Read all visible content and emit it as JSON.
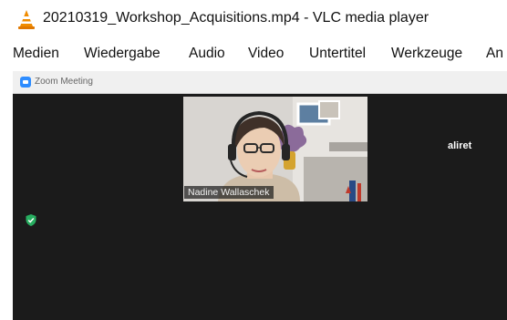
{
  "window": {
    "title": "20210319_Workshop_Acquisitions.mp4 - VLC media player",
    "icon": "vlc-cone-icon"
  },
  "menu": [
    {
      "label": "Medien"
    },
    {
      "label": "Wiedergabe"
    },
    {
      "label": "Audio"
    },
    {
      "label": "Video"
    },
    {
      "label": "Untertitel"
    },
    {
      "label": "Werkzeuge"
    },
    {
      "label": "An"
    }
  ],
  "zoom": {
    "window_title": "Zoom Meeting",
    "participants": [
      {
        "name": "Nadine Wallaschek"
      },
      {
        "name": "aliret"
      }
    ],
    "colors": {
      "accent": "#2d8cff",
      "shield": "#27ae60",
      "background": "#1b1b1b"
    }
  }
}
